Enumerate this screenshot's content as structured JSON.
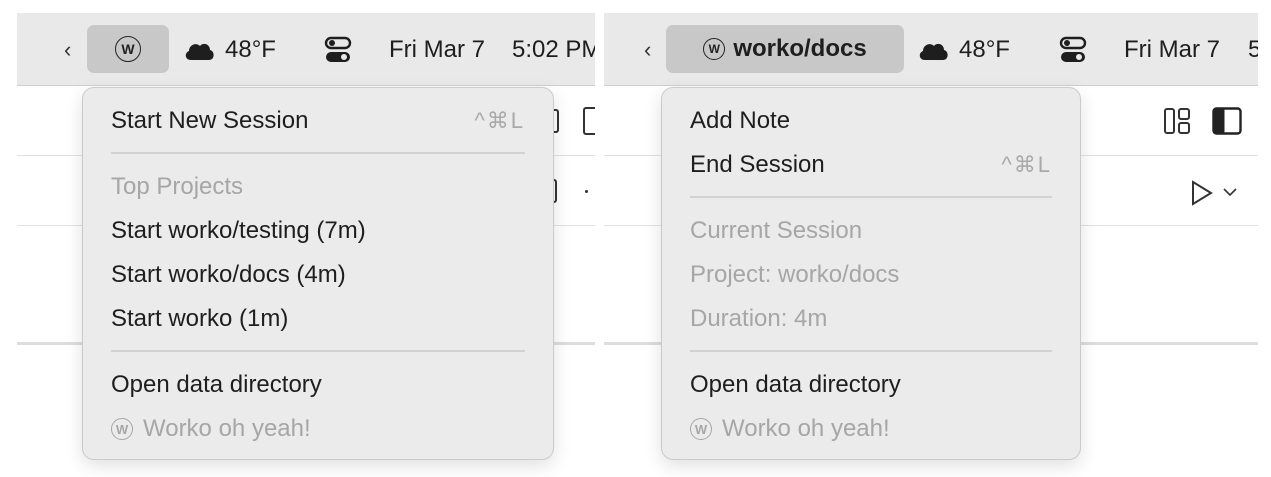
{
  "left": {
    "menubar": {
      "app_icon": "worko-w-icon",
      "weather_icon": "cloud-icon",
      "temperature": "48°F",
      "control_icon": "control-center-icon",
      "date": "Fri Mar 7",
      "time": "5:02 PM"
    },
    "menu": {
      "start_new_session": {
        "label": "Start New Session",
        "shortcut": "^⌘L"
      },
      "section_title": "Top Projects",
      "projects": [
        "Start worko/testing (7m)",
        "Start worko/docs (4m)",
        "Start worko (1m)"
      ],
      "open_data_dir": "Open data directory",
      "footer": "Worko oh yeah!"
    }
  },
  "right": {
    "menubar": {
      "app_icon": "worko-w-icon",
      "app_label": "worko/docs",
      "weather_icon": "cloud-icon",
      "temperature": "48°F",
      "control_icon": "control-center-icon",
      "date": "Fri Mar 7",
      "time": "5"
    },
    "menu": {
      "add_note": "Add Note",
      "end_session": {
        "label": "End Session",
        "shortcut": "^⌘L"
      },
      "section_title": "Current Session",
      "project": "Project: worko/docs",
      "duration": "Duration: 4m",
      "open_data_dir": "Open data directory",
      "footer": "Worko oh yeah!"
    }
  },
  "colors": {
    "menubar_bg": "#e9e9e9",
    "menu_bg": "#ebebeb",
    "active_app_bg": "#c8c8c8",
    "disabled_text": "#a6a6a6"
  }
}
